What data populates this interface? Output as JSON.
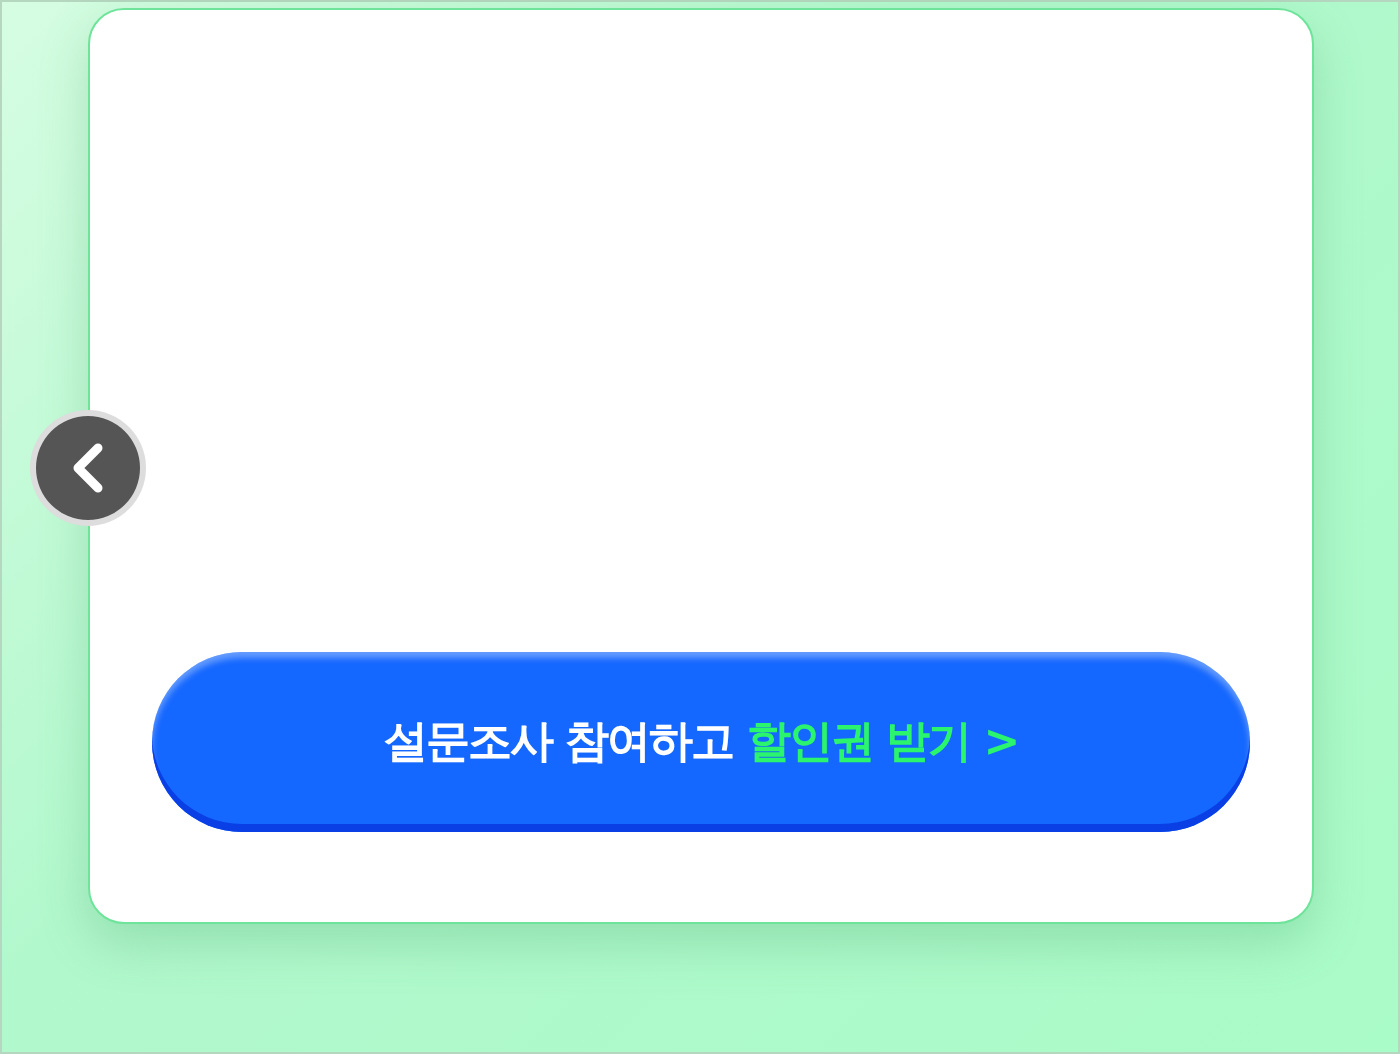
{
  "survey_button": {
    "label": "설문조사 참여하고",
    "highlight": "할인권 받기 >"
  }
}
